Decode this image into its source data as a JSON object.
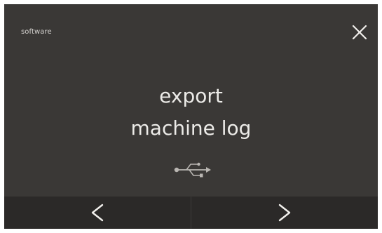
{
  "header": {
    "breadcrumb": "software",
    "close_icon": "close-icon"
  },
  "main": {
    "title_line1": "export",
    "title_line2": "machine log",
    "status_icon": "usb-icon"
  },
  "nav": {
    "prev_icon": "chevron-left-icon",
    "next_icon": "chevron-right-icon"
  },
  "colors": {
    "background": "#3a3836",
    "nav_bar": "#2b2928",
    "text": "#ecebe8"
  }
}
